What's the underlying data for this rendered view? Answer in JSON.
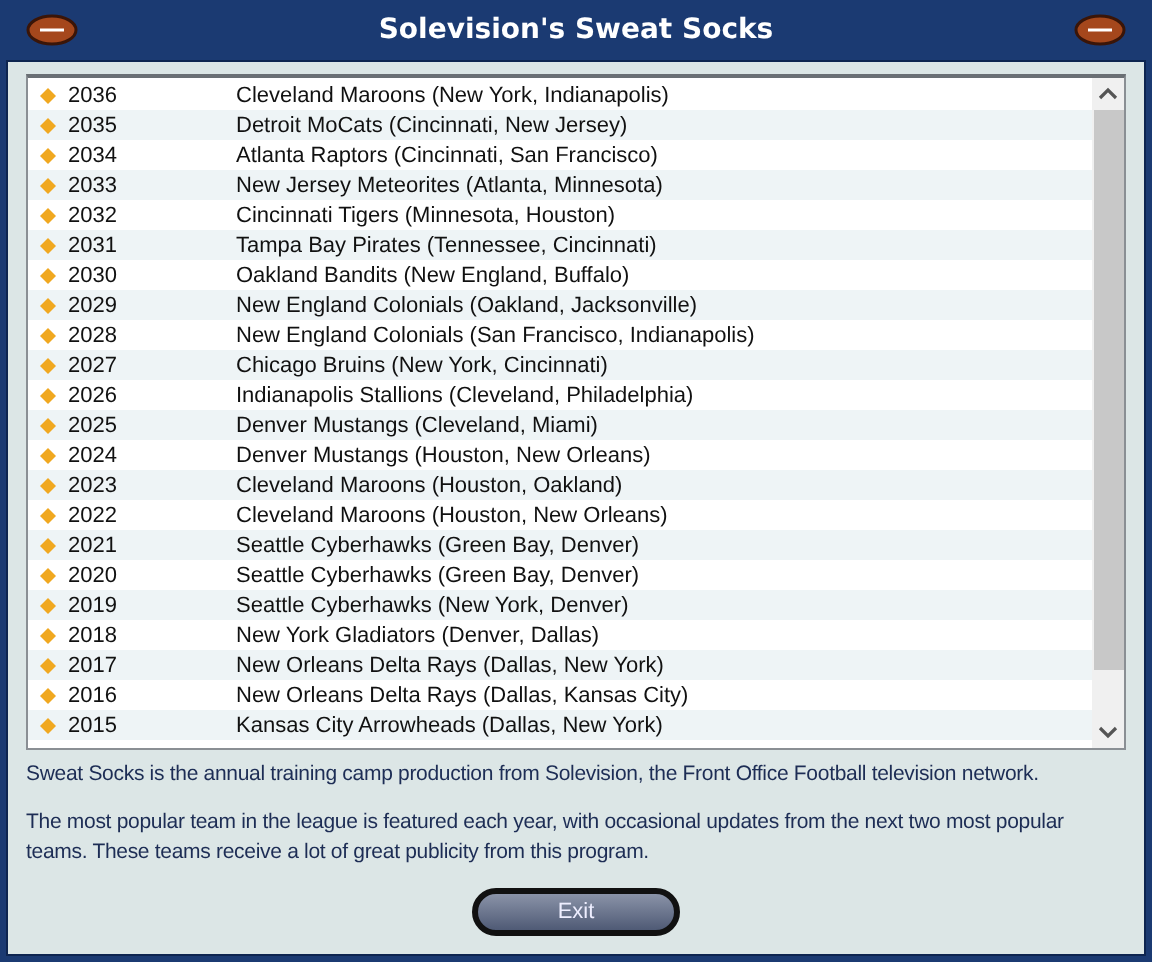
{
  "window": {
    "title": "Solevision's Sweat Socks"
  },
  "rows": [
    {
      "year": "2036",
      "teams": "Cleveland Maroons (New York, Indianapolis)"
    },
    {
      "year": "2035",
      "teams": "Detroit MoCats (Cincinnati, New Jersey)"
    },
    {
      "year": "2034",
      "teams": "Atlanta Raptors (Cincinnati, San Francisco)"
    },
    {
      "year": "2033",
      "teams": "New Jersey Meteorites (Atlanta, Minnesota)"
    },
    {
      "year": "2032",
      "teams": "Cincinnati Tigers (Minnesota, Houston)"
    },
    {
      "year": "2031",
      "teams": "Tampa Bay Pirates (Tennessee, Cincinnati)"
    },
    {
      "year": "2030",
      "teams": "Oakland Bandits (New England, Buffalo)"
    },
    {
      "year": "2029",
      "teams": "New England Colonials (Oakland, Jacksonville)"
    },
    {
      "year": "2028",
      "teams": "New England Colonials (San Francisco, Indianapolis)"
    },
    {
      "year": "2027",
      "teams": "Chicago Bruins (New York, Cincinnati)"
    },
    {
      "year": "2026",
      "teams": "Indianapolis Stallions (Cleveland, Philadelphia)"
    },
    {
      "year": "2025",
      "teams": "Denver Mustangs (Cleveland, Miami)"
    },
    {
      "year": "2024",
      "teams": "Denver Mustangs (Houston, New Orleans)"
    },
    {
      "year": "2023",
      "teams": "Cleveland Maroons (Houston, Oakland)"
    },
    {
      "year": "2022",
      "teams": "Cleveland Maroons (Houston, New Orleans)"
    },
    {
      "year": "2021",
      "teams": "Seattle Cyberhawks (Green Bay, Denver)"
    },
    {
      "year": "2020",
      "teams": "Seattle Cyberhawks (Green Bay, Denver)"
    },
    {
      "year": "2019",
      "teams": "Seattle Cyberhawks (New York, Denver)"
    },
    {
      "year": "2018",
      "teams": "New York Gladiators (Denver, Dallas)"
    },
    {
      "year": "2017",
      "teams": "New Orleans Delta Rays (Dallas, New York)"
    },
    {
      "year": "2016",
      "teams": "New Orleans Delta Rays (Dallas, Kansas City)"
    },
    {
      "year": "2015",
      "teams": "Kansas City Arrowheads (Dallas, New York)"
    }
  ],
  "paragraphs": [
    "Sweat Socks is the annual training camp production from Solevision, the Front Office Football television network.",
    "The most popular team in the league is featured each year, with occasional updates from the next two most popular teams. These teams receive a lot of great publicity from this program."
  ],
  "button": "Exit"
}
